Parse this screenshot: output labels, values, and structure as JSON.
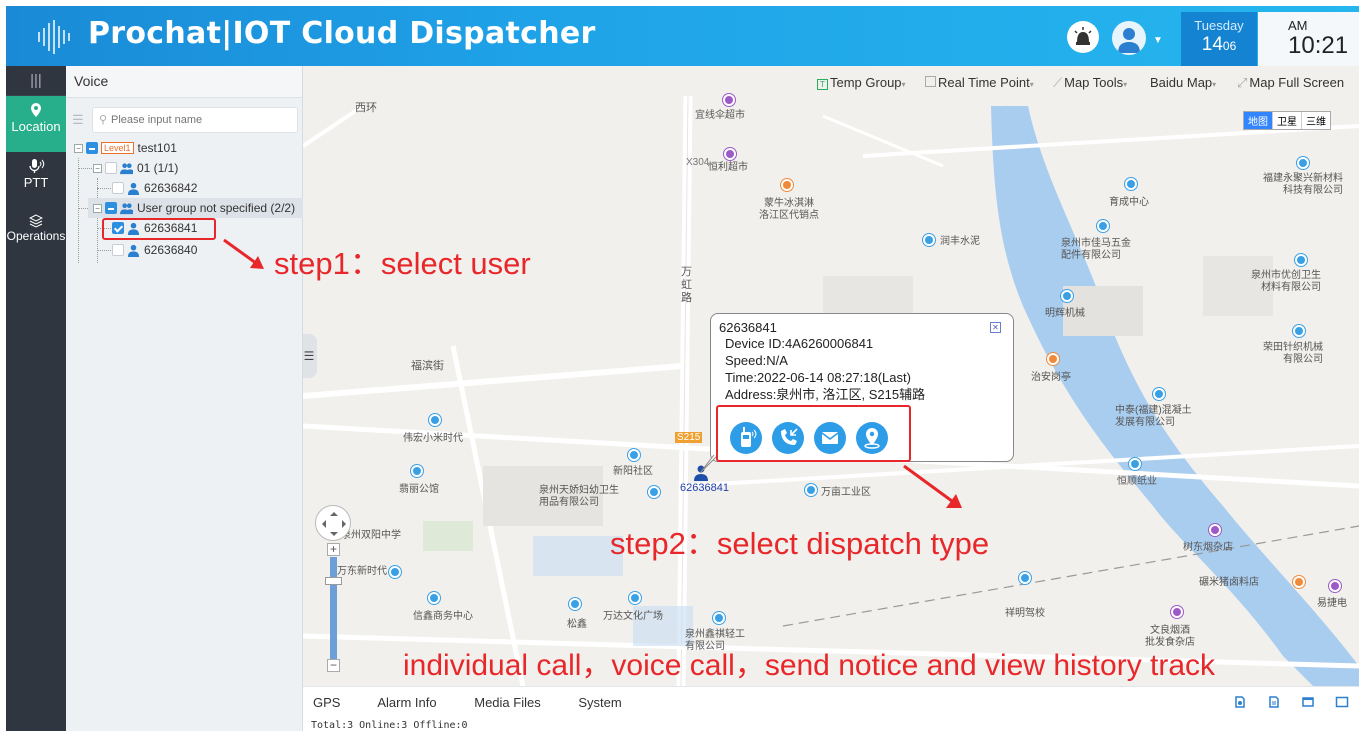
{
  "header": {
    "title": "Prochat|IOT Cloud Dispatcher",
    "day": "Tuesday",
    "date": "14",
    "date_sub": "06",
    "ampm": "AM",
    "time": "10:21"
  },
  "nav": {
    "items": [
      {
        "label": "Location",
        "icon": "location-icon"
      },
      {
        "label": "PTT",
        "icon": "mic-icon"
      },
      {
        "label": "Operations",
        "icon": "layers-icon"
      }
    ]
  },
  "panel": {
    "title": "Voice",
    "search_placeholder": "Please input name",
    "tree": {
      "root": "test101",
      "root_badge": "Level1",
      "group1": "01 (1/1)",
      "user1": "62636842",
      "group2": "User group not specified (2/2)",
      "user2": "62636841",
      "user3": "62636840"
    }
  },
  "toolbar": {
    "temp_group": "Temp Group",
    "real_time_point": "Real Time Point",
    "map_tools": "Map Tools",
    "baidu_map": "Baidu Map",
    "full_screen": "Map Full Screen"
  },
  "maptype": [
    "地图",
    "卫星",
    "三维"
  ],
  "popup": {
    "id": "62636841",
    "device_id": "Device ID:4A6260006841",
    "speed": "Speed:N/A",
    "time": "Time:2022-06-14 08:27:18(Last)",
    "address": "Address:泉州市, 洛江区, S215辅路"
  },
  "marker_label": "62636841",
  "annotations": {
    "step1": "step1：select user",
    "step2": "step2：select dispatch type",
    "step3": "individual call，voice call，send notice and view history track"
  },
  "map_labels": {
    "l1": "宜线伞超市",
    "l2": "恒利超市",
    "l3": "蒙牛冰淇淋",
    "l3b": "洛江区代销点",
    "l4": "润丰水泥",
    "l5": "育成中心",
    "l6": "福建永聚兴新材料",
    "l6b": "科技有限公司",
    "l7": "泉州市佳马五金",
    "l7b": "配件有限公司",
    "l8": "泉州市优创卫生",
    "l8b": "材料有限公司",
    "l9": "明辉机械",
    "l10": "荣田针织机械",
    "l10b": "有限公司",
    "l11": "治安岗亭",
    "l12": "中泰(福建)混凝土",
    "l12b": "发展有限公司",
    "l13": "福滨街",
    "l14": "伟宏小米时代",
    "l15": "新阳社区",
    "l16": "泉州天娇妇幼卫生",
    "l16b": "用品有限公司",
    "l17": "万亩工业区",
    "l18": "恒顺纸业",
    "l19": "翡丽公馆",
    "l20": "泉州双阳中学",
    "l21": "树东烟杂店",
    "l22": "碾米猪卤料店",
    "l23": "易捷电",
    "l24": "万东新时代",
    "l25": "信鑫商务中心",
    "l26": "万达文化广场",
    "l27": "松鑫",
    "l28": "泉州鑫祺轻工",
    "l28b": "有限公司",
    "l29": "祥明驾校",
    "l30": "文良烟酒",
    "l30b": "批发食杂店",
    "l31": "西环",
    "l32": "万虹路",
    "road_x304": "X304",
    "road_s215": "S215"
  },
  "bottom": {
    "tabs": [
      "GPS",
      "Alarm Info",
      "Media Files",
      "System"
    ],
    "status": "Total:3  Online:3  Offline:0"
  },
  "colors": {
    "header": "#1fa3e8",
    "nav_bg": "#2f3640",
    "nav_active": "#27ae8a",
    "annotation": "#e8272a",
    "action_button": "#2d9de8"
  }
}
